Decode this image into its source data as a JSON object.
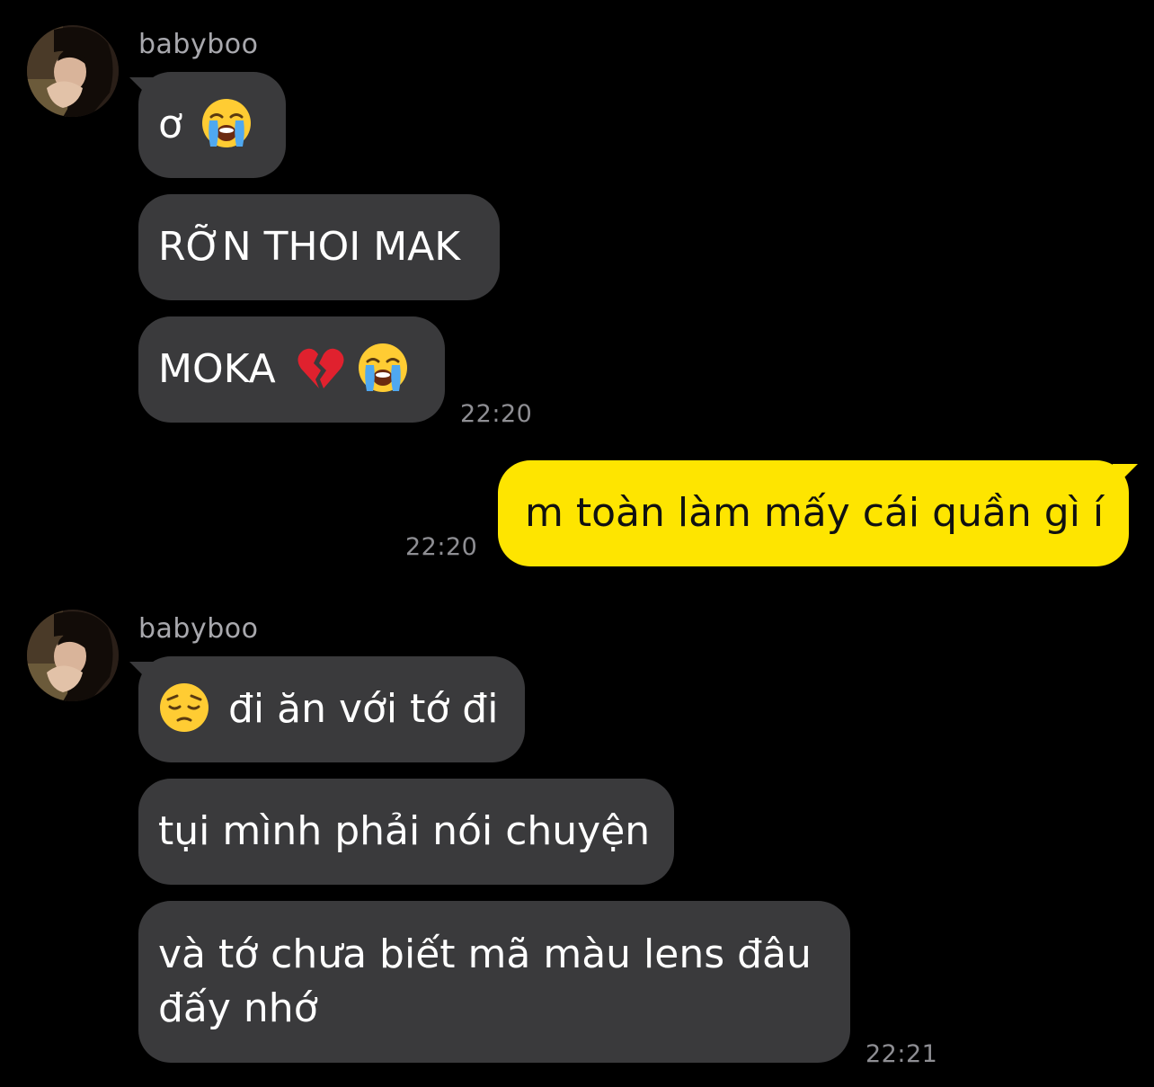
{
  "colors": {
    "background": "#000000",
    "incoming_bubble": "#3a3a3c",
    "outgoing_bubble": "#fee500",
    "timestamp": "#8e8e93",
    "sender_name": "#a8a8ad"
  },
  "groups": [
    {
      "sender": "babyboo",
      "messages": [
        {
          "text": "ơ",
          "emoji": [
            "loudly-crying-face"
          ]
        },
        {
          "text": "RỠN THOI MAK"
        },
        {
          "text": "MOKA",
          "emoji": [
            "broken-heart",
            "loudly-crying-face"
          ]
        }
      ],
      "time": "22:20"
    },
    {
      "sender": "me",
      "messages": [
        {
          "text": "m toàn làm mấy cái quần gì í"
        }
      ],
      "time": "22:20"
    },
    {
      "sender": "babyboo",
      "messages": [
        {
          "text": "đi ăn với tớ đi",
          "emoji": [
            "pensive-face"
          ]
        },
        {
          "text": "tụi mình phải nói chuyện"
        },
        {
          "text": "và tớ chưa biết mã màu lens đâu đấy nhớ"
        }
      ],
      "time": "22:21"
    }
  ]
}
